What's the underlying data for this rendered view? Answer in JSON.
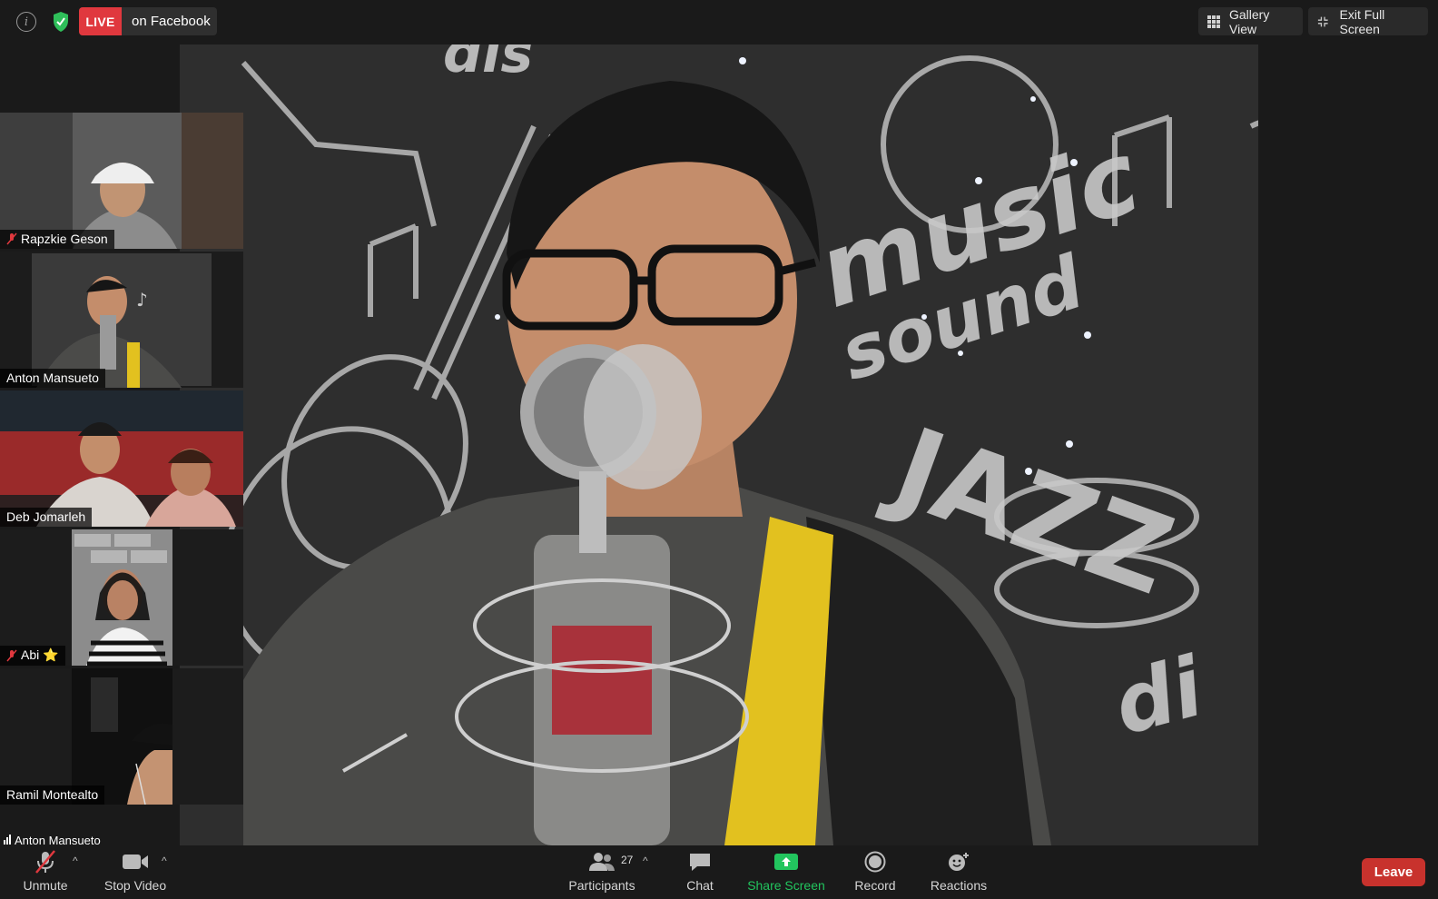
{
  "topbar": {
    "info_icon": "info-icon",
    "security_icon": "shield-check-icon",
    "live_badge": "LIVE",
    "live_destination": "on Facebook",
    "gallery_view_label": "Gallery View",
    "exit_fullscreen_label": "Exit Full Screen"
  },
  "main_video": {
    "speaker": "Anton Mansueto",
    "backdrop_text": [
      "music",
      "sound",
      "JAZZ",
      "dis",
      "di"
    ]
  },
  "participants_panel": [
    {
      "name": "Rapzkie Geson",
      "muted": true,
      "active": false
    },
    {
      "name": "Anton Mansueto",
      "muted": false,
      "active": true
    },
    {
      "name": "Deb Jomarleh",
      "muted": false,
      "active": false
    },
    {
      "name": "Abi ⭐",
      "muted": true,
      "active": false
    },
    {
      "name": "Ramil Montealto",
      "muted": false,
      "active": false
    }
  ],
  "active_speaker_label": "Anton Mansueto",
  "toolbar": {
    "unmute_label": "Unmute",
    "stop_video_label": "Stop Video",
    "participants_label": "Participants",
    "participants_count": "27",
    "chat_label": "Chat",
    "share_screen_label": "Share Screen",
    "record_label": "Record",
    "reactions_label": "Reactions",
    "leave_label": "Leave"
  },
  "colors": {
    "live_red": "#e0383e",
    "share_green": "#22c55e",
    "leave_red": "#c8322d",
    "active_outline": "#d6d76b"
  }
}
